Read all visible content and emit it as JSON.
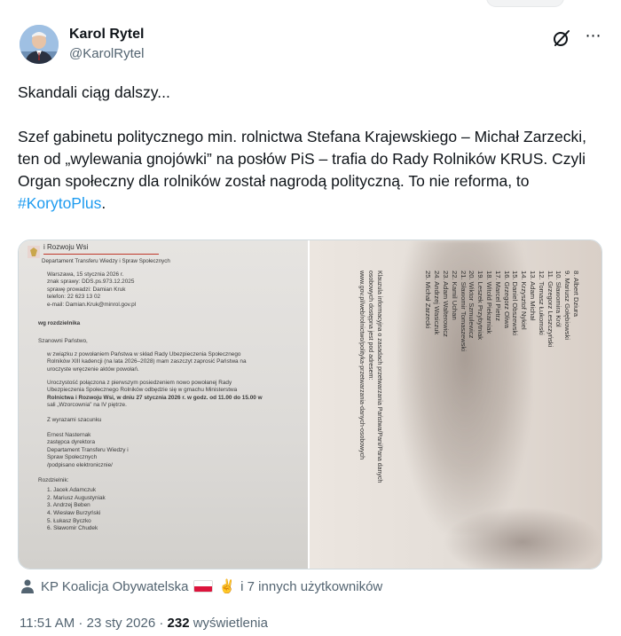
{
  "author": {
    "name": "Karol Rytel",
    "handle": "@KarolRytel"
  },
  "actions": {
    "grok_icon": "grok-icon",
    "more_label": "⋯"
  },
  "tweet": {
    "line1": "Skandali ciąg dalszy...",
    "body": "Szef gabinetu politycznego min. rolnictwa Stefana Krajewskiego – Michał Zarzecki, ten od „wylewania gnojówki” na posłów PiS – trafia do Rady Rolników KRUS. Czyli Organ społeczny dla rolników został nagrodą polityczną. To nie reforma, to ",
    "hashtag": "#KorytoPlus",
    "hashtag_color": "#1d9bf0"
  },
  "document_left": {
    "header": "i Rozwoju Wsi",
    "department": "Departament Transferu Wiedzy i Spraw Społecznych",
    "meta": [
      "Warszawa, 15 stycznia 2026 r.",
      "znak sprawy: DDS.ps.973.12.2025",
      "sprawę prowadzi: Damian Kruk",
      "telefon: 22 623 13 02",
      "e-mail: Damian.Kruk@minrol.gov.pl"
    ],
    "addressee": "wg rozdzielnika",
    "greeting": "Szanowni Państwo,",
    "para1": [
      "w związku z powołaniem Państwa w skład Rady Ubezpieczenia Społecznego",
      "Rolników XIII kadencji (na lata 2026–2028) mam zaszczyt zaprosić Państwa na",
      "uroczyste wręczenie aktów powołań."
    ],
    "para2": [
      "Uroczystość połączona z pierwszym posiedzeniem nowo powołanej Rady",
      "Ubezpieczenia Społecznego Rolników odbędzie się w gmachu Ministerstwa",
      "Rolnictwa i Rozwoju Wsi, w dniu 27 stycznia 2026 r. w godz. od 11.00 do 15.00 w",
      "sali „Wzorcownia” na IV piętrze."
    ],
    "closing": "Z wyrazami szacunku",
    "signature": [
      "Ernest Nasternak",
      "zastępca dyrektora",
      "Departament Transferu Wiedzy i",
      "Spraw Społecznych",
      "/podpisano elektronicznie/"
    ],
    "distribution_label": "Rozdzielnik:",
    "distribution": [
      "1. Jacek Adamczuk",
      "2. Mariusz Augustyniak",
      "3. Andrzej Beben",
      "4. Wiesław Burzyński",
      "5. Łukasz Byczko",
      "6. Sławomir Chudek"
    ]
  },
  "document_right": {
    "list": [
      "8. Albert Dziura",
      "9. Mariusz Gołębiowski",
      "10. Sławomira Król",
      "11. Grzegorz Leszczyński",
      "12. Tomasz Łukomski",
      "13. Adam Michał",
      "14. Krzysztof Nykiel",
      "15. Daniel Obszewski",
      "16. Grzegorz Oliwa",
      "17. Marcel Pietrz",
      "18. Witold Piekarniak",
      "19. Leszek Przybytniak",
      "20. Wiktor Szmulewicz",
      "21. Sławomir Tomaszewski",
      "22. Kamil Uchan",
      "23. Adam Walterowicz",
      "24. Andrzej Wasiczuk",
      "25. Michał Zarzecki"
    ],
    "footer": [
      "Klauzula informacyjna o zasadach przetwarzania Państwa/Pani/Pana danych",
      "osobowych dostępna jest pod adresem:",
      "www.gov.pl/web/rolnictwo/polityka-przetwarzania-danych-osobowych"
    ]
  },
  "liked_by": {
    "text_prefix": "KP Koalicja Obywatelska",
    "emoji": "✌️",
    "text_suffix": "i 7 innych użytkowników"
  },
  "meta": {
    "time": "11:51 AM",
    "separator": " · ",
    "date": "23 sty 2026",
    "separator2": " · ",
    "views": "232",
    "views_label": " wyświetlenia"
  }
}
